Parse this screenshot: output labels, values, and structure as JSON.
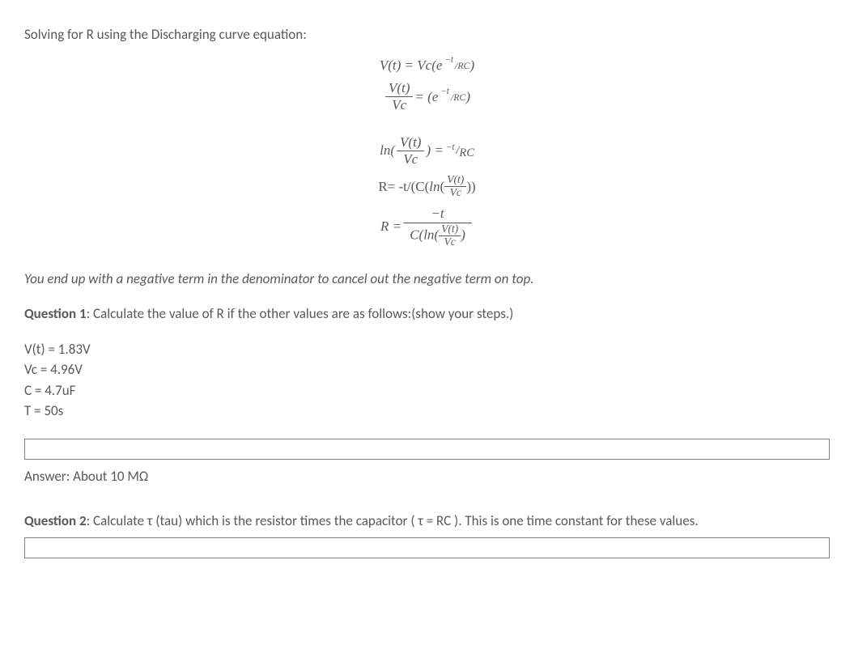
{
  "intro": "Solving for R using the Discharging curve equation:",
  "eq": {
    "line1_left": "V(t) = Vc(e",
    "line1_sup_num": "−t",
    "line1_sup_slash": "/",
    "line1_sup_den": "RC",
    "line1_right": ")",
    "line2_num": "V(t)",
    "line2_den": "Vc",
    "line2_mid": " = (e",
    "line2_right": ")",
    "line3_left": "ln(",
    "line3_num": "V(t)",
    "line3_den": "Vc",
    "line3_mid": ") = ",
    "line3_sup_num": "−t",
    "line3_sup_den": "RC",
    "line4_left": "R= -t/(C(ln(",
    "line4_num": "V(t)",
    "line4_den": "Vc",
    "line4_right": "))",
    "line5_left": "R = ",
    "line5_num": "−t",
    "line5_den_left": "C(ln(",
    "line5_den_num": "V(t)",
    "line5_den_den": "Vc",
    "line5_den_right": ")"
  },
  "note": "You end up with a negative term in the denominator to cancel out the negative term on top.",
  "q1": {
    "label": "Question 1",
    "text": ":  Calculate the value of R if the other values are as follows:(show your steps.)"
  },
  "given": {
    "vt": "V(t) = 1.83V",
    "vc": "Vc = 4.96V",
    "c": "C = 4.7uF",
    "t": "T = 50s"
  },
  "input1": "",
  "answer1": "Answer:  About 10 MΩ",
  "q2": {
    "label": "Question 2",
    "text": ":  Calculate τ (tau) which is the resistor times the capacitor ( τ = RC ).  This is one time constant for these values."
  },
  "input2": ""
}
